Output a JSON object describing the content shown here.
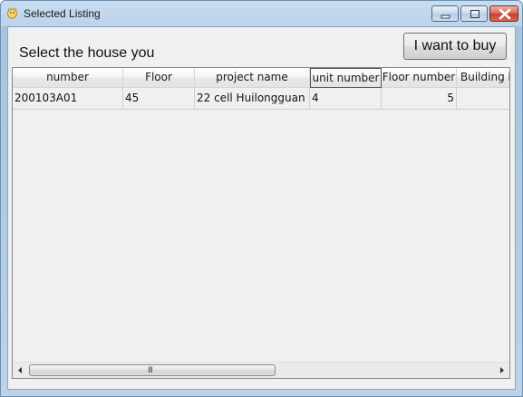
{
  "window": {
    "title": "Selected Listing",
    "icon": "app-icon"
  },
  "caption_buttons": {
    "minimize": "minimize-icon",
    "maximize": "maximize-icon",
    "close": "close-icon"
  },
  "header": {
    "prompt": "Select the house you",
    "buy_button": "I want to buy"
  },
  "table": {
    "columns": [
      "number",
      "Floor",
      "project name",
      "unit number",
      "Floor number",
      "Building ho"
    ],
    "rows": [
      [
        "200103A01",
        "45",
        "22 cell Huilongguan",
        "4",
        "5",
        ""
      ]
    ]
  },
  "scrollbar": {
    "grip": "III"
  },
  "colors": {
    "title_bar": "#bcd3ea",
    "close_button": "#c43f2f",
    "client_bg": "#f0f0f0"
  }
}
